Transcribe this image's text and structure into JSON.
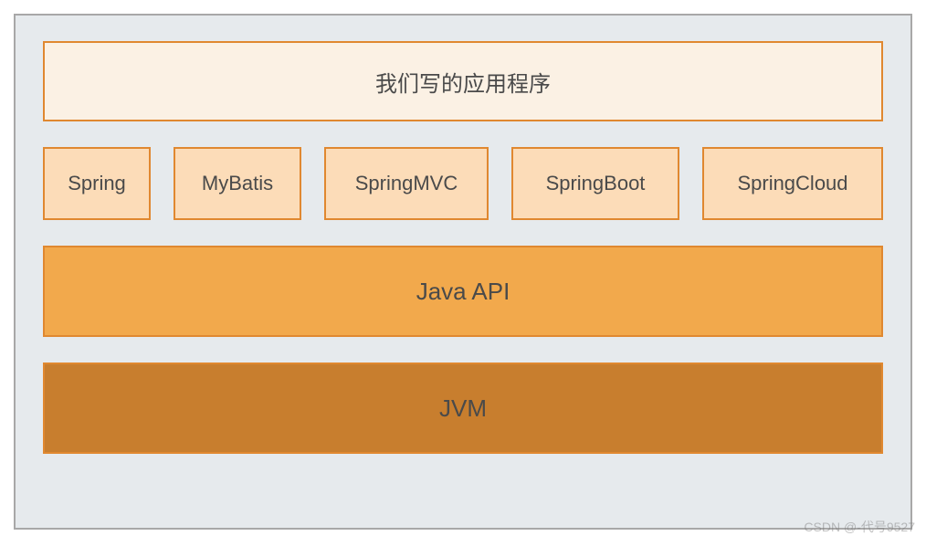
{
  "layers": {
    "application": "我们写的应用程序",
    "frameworks": [
      "Spring",
      "MyBatis",
      "SpringMVC",
      "SpringBoot",
      "SpringCloud"
    ],
    "api": "Java API",
    "jvm": "JVM"
  },
  "watermark": "CSDN @-代号9527"
}
